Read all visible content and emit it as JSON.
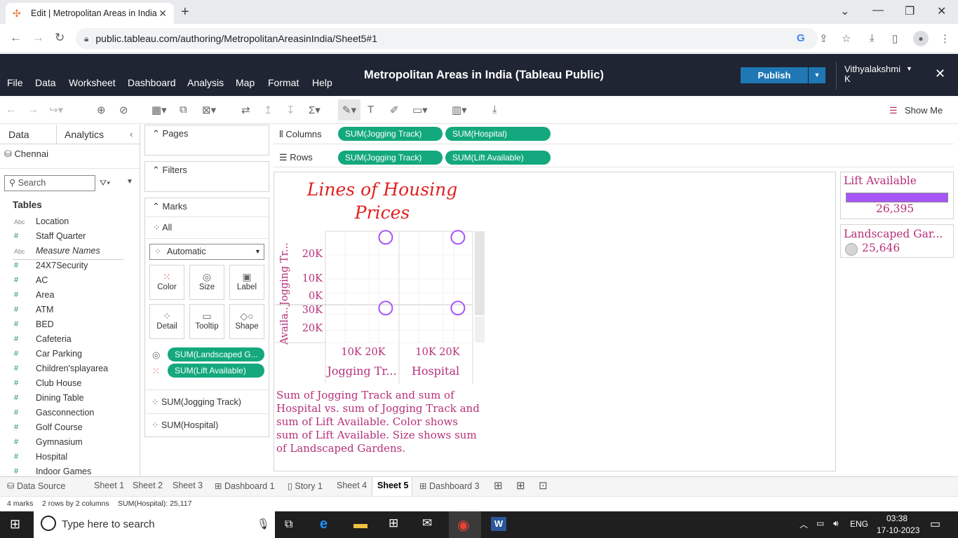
{
  "browser": {
    "tab_title": "Edit | Metropolitan Areas in India",
    "url": "public.tableau.com/authoring/MetropolitanAreasinIndia/Sheet5#1"
  },
  "header": {
    "menus": [
      "File",
      "Data",
      "Worksheet",
      "Dashboard",
      "Analysis",
      "Map",
      "Format",
      "Help"
    ],
    "title": "Metropolitan Areas in India (Tableau Public)",
    "publish_label": "Publish",
    "user_line1": "Vithyalakshmi",
    "user_line2": "K"
  },
  "toolbar": {
    "show_me": "Show Me"
  },
  "data_pane": {
    "tab_data": "Data",
    "tab_analytics": "Analytics",
    "datasource": "Chennai",
    "search_placeholder": "Search",
    "tables_label": "Tables",
    "fields": [
      {
        "type": "Abc",
        "name": "Location"
      },
      {
        "type": "#",
        "name": "Staff Quarter"
      },
      {
        "type": "Abc",
        "name": "Measure Names"
      },
      {
        "type": "#",
        "name": "24X7Security"
      },
      {
        "type": "#",
        "name": "AC"
      },
      {
        "type": "#",
        "name": "Area"
      },
      {
        "type": "#",
        "name": "ATM"
      },
      {
        "type": "#",
        "name": "BED"
      },
      {
        "type": "#",
        "name": "Cafeteria"
      },
      {
        "type": "#",
        "name": "Car Parking"
      },
      {
        "type": "#",
        "name": "Children'splayarea"
      },
      {
        "type": "#",
        "name": "Club House"
      },
      {
        "type": "#",
        "name": "Dining Table"
      },
      {
        "type": "#",
        "name": "Gasconnection"
      },
      {
        "type": "#",
        "name": "Golf Course"
      },
      {
        "type": "#",
        "name": "Gymnasium"
      },
      {
        "type": "#",
        "name": "Hospital"
      },
      {
        "type": "#",
        "name": "Indoor Games"
      }
    ]
  },
  "cards": {
    "pages": "Pages",
    "filters": "Filters",
    "marks": "Marks",
    "all": "All",
    "mark_type": "Automatic",
    "buttons": [
      "Color",
      "Size",
      "Label",
      "Detail",
      "Tooltip",
      "Shape"
    ],
    "mark_pills": [
      "SUM(Landscaped G...",
      "SUM(Lift Available)"
    ],
    "mark_fields": [
      "SUM(Jogging Track)",
      "SUM(Hospital)"
    ]
  },
  "shelves": {
    "columns_label": "Columns",
    "rows_label": "Rows",
    "columns": [
      "SUM(Jogging Track)",
      "SUM(Hospital)"
    ],
    "rows": [
      "SUM(Jogging Track)",
      "SUM(Lift Available)"
    ]
  },
  "viz": {
    "title": "Lines of Housing Prices",
    "row_headers": [
      "Jogging Tr...",
      "Availa..."
    ],
    "y_ticks_top": [
      "20K",
      "10K",
      "0K"
    ],
    "y_ticks_bottom": [
      "30K",
      "20K"
    ],
    "x_ticks": [
      "10K 20K",
      "10K 20K"
    ],
    "col_headers": [
      "Jogging Tr...",
      "Hospital"
    ],
    "caption": "Sum of Jogging Track and sum of Hospital vs. sum of Jogging Track and sum of Lift Available.  Color shows sum of Lift Available.  Size shows sum of Landscaped Gardens.",
    "mark_color": "#a855f7",
    "text_color": "#b5307a"
  },
  "chart_data": {
    "type": "scatter",
    "title": "Lines of Housing Prices",
    "panes": [
      {
        "row": "SUM(Jogging Track)",
        "col": "SUM(Jogging Track)",
        "x": 25646,
        "y": 25646
      },
      {
        "row": "SUM(Jogging Track)",
        "col": "SUM(Hospital)",
        "x": 25117,
        "y": 25646
      },
      {
        "row": "SUM(Lift Available)",
        "col": "SUM(Jogging Track)",
        "x": 25646,
        "y": 26395
      },
      {
        "row": "SUM(Lift Available)",
        "col": "SUM(Hospital)",
        "x": 25117,
        "y": 26395
      }
    ]
  },
  "legends": {
    "lift_title": "Lift Available",
    "lift_value": "26,395",
    "lift_color": "#a855f7",
    "land_title": "Landscaped Gar...",
    "land_value": "25,646"
  },
  "sheet_tabs": [
    "Data Source",
    "Sheet 1",
    "Sheet 2",
    "Sheet 3",
    "Dashboard 1",
    "Story 1",
    "Sheet 4",
    "Sheet 5",
    "Dashboard 3"
  ],
  "active_sheet": "Sheet 5",
  "status": {
    "marks": "4 marks",
    "dims": "2 rows by 2 columns",
    "sum": "SUM(Hospital): 25,117"
  },
  "taskbar": {
    "search_placeholder": "Type here to search",
    "lang": "ENG",
    "time": "03:38",
    "date": "17-10-2023"
  }
}
